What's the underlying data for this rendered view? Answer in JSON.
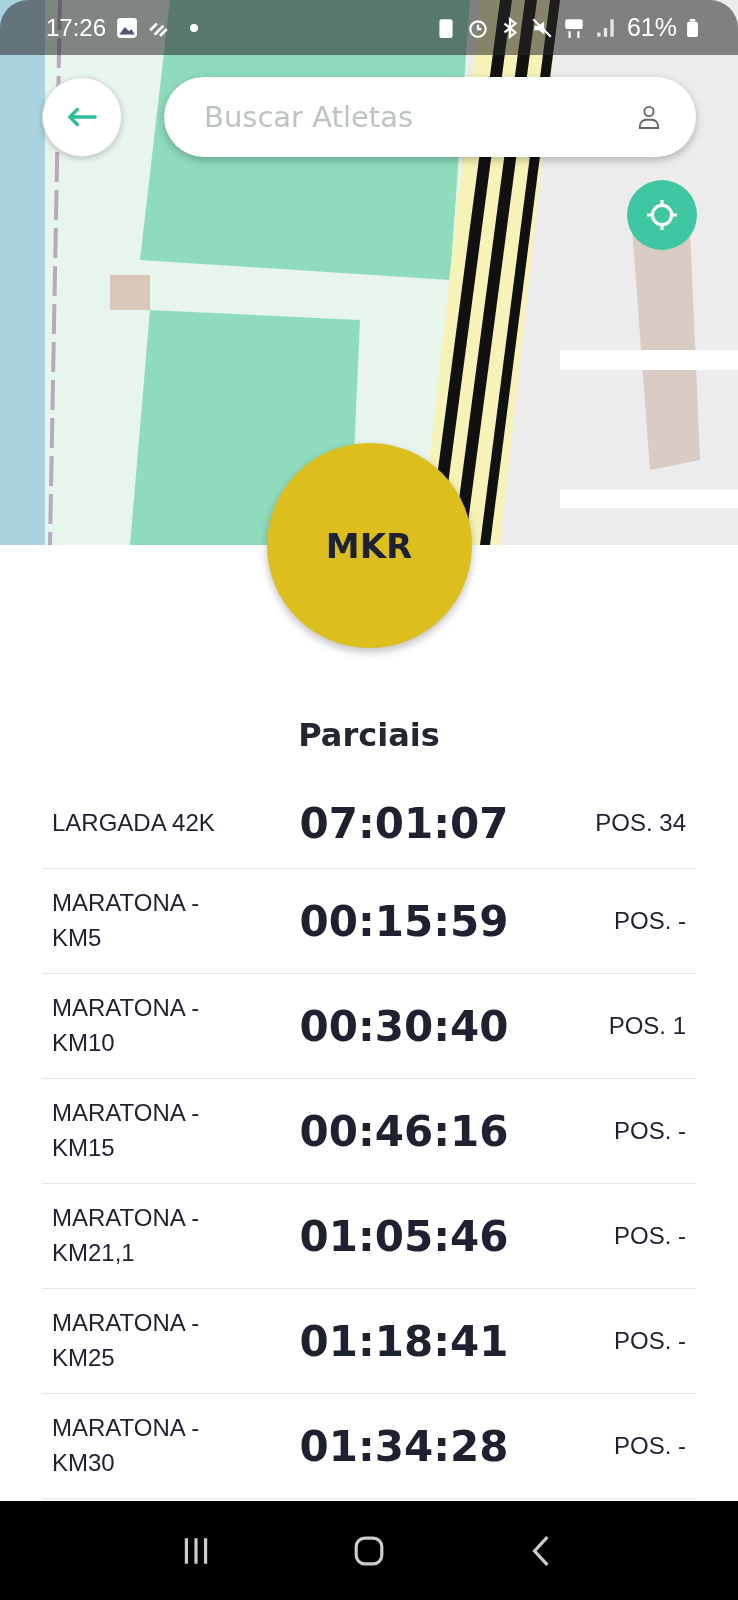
{
  "status_bar": {
    "time": "17:26",
    "battery": "61%"
  },
  "search": {
    "placeholder": "Buscar Atletas"
  },
  "athlete": {
    "initials": "MKR"
  },
  "section_title": "Parciais",
  "splits": [
    {
      "label": "LARGADA 42K",
      "time": "07:01:07",
      "position": "POS. 34"
    },
    {
      "label": "MARATONA - KM5",
      "time": "00:15:59",
      "position": "POS. -"
    },
    {
      "label": "MARATONA - KM10",
      "time": "00:30:40",
      "position": "POS. 1"
    },
    {
      "label": "MARATONA - KM15",
      "time": "00:46:16",
      "position": "POS. -"
    },
    {
      "label": "MARATONA - KM21,1",
      "time": "01:05:46",
      "position": "POS. -"
    },
    {
      "label": "MARATONA - KM25",
      "time": "01:18:41",
      "position": "POS. -"
    },
    {
      "label": "MARATONA - KM30",
      "time": "01:34:28",
      "position": "POS. -"
    }
  ]
}
